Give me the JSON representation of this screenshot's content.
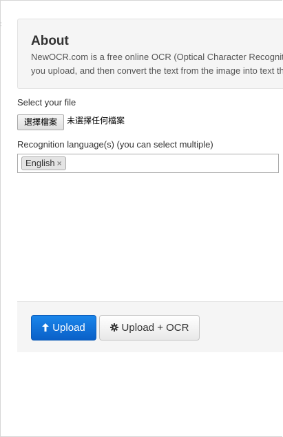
{
  "about": {
    "title": "About",
    "line1": "NewOCR.com is a free online OCR (Optical Character Recognit",
    "line2": "you upload, and then convert the text from the image into text th"
  },
  "file": {
    "label": "Select your file",
    "button_label": "選擇檔案",
    "status": "未選擇任何檔案"
  },
  "language": {
    "label": "Recognition language(s) (you can select multiple)",
    "tags": [
      {
        "label": "English",
        "remove": "×"
      }
    ]
  },
  "actions": {
    "upload_label": "Upload",
    "upload_icon": "arrow-up-icon",
    "upload_ocr_label": "Upload + OCR",
    "upload_ocr_icon": "gear-icon"
  },
  "colors": {
    "primary": "#0a6fd8",
    "panel_bg": "#f5f5f5"
  }
}
